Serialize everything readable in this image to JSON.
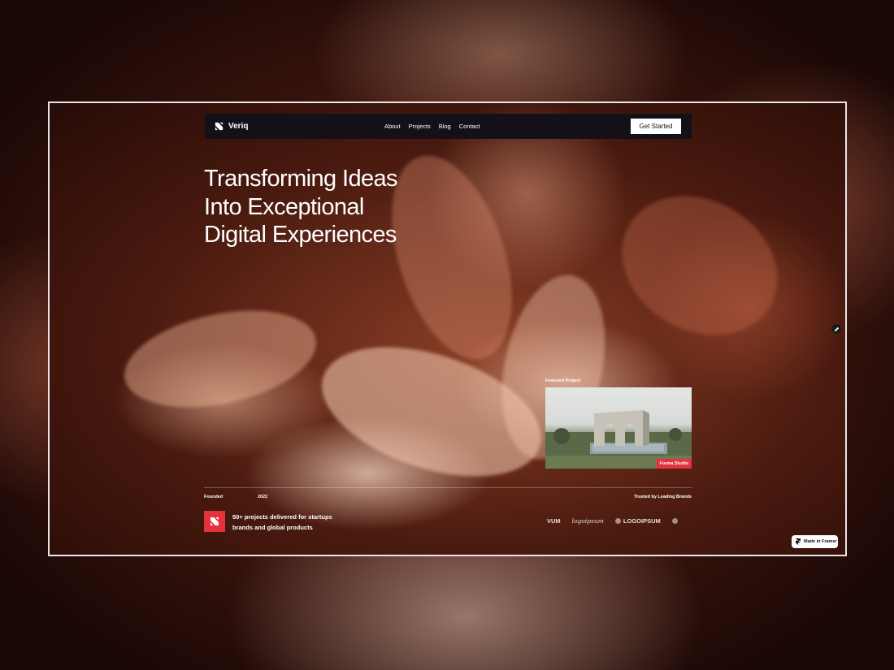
{
  "navbar": {
    "brand": "Veriq",
    "links": [
      "About",
      "Projects",
      "Blog",
      "Contact"
    ],
    "cta_label": "Get Started"
  },
  "hero": {
    "title_lines": [
      "Transforming Ideas",
      "Into Exceptional",
      "Digital Experiences"
    ]
  },
  "featured": {
    "label": "Featured Project",
    "badge": "Forma Studio"
  },
  "footer": {
    "founded_label": "Founded",
    "founded_year": "2022",
    "stat_text": "50+ projects delivered for startups brands and global products",
    "trusted_label": "Trusted by Leading Brands",
    "brands": [
      "VUM",
      "logoipsum",
      "LOGOIPSUM"
    ]
  },
  "framer_badge": "Made in Framer",
  "colors": {
    "accent": "#e5323c",
    "navbar_bg": "#141018",
    "frame_border": "#e9e4e7"
  },
  "icons": [
    "logo-mark-icon",
    "edit-icon",
    "framer-icon",
    "brand-dot-icon"
  ]
}
